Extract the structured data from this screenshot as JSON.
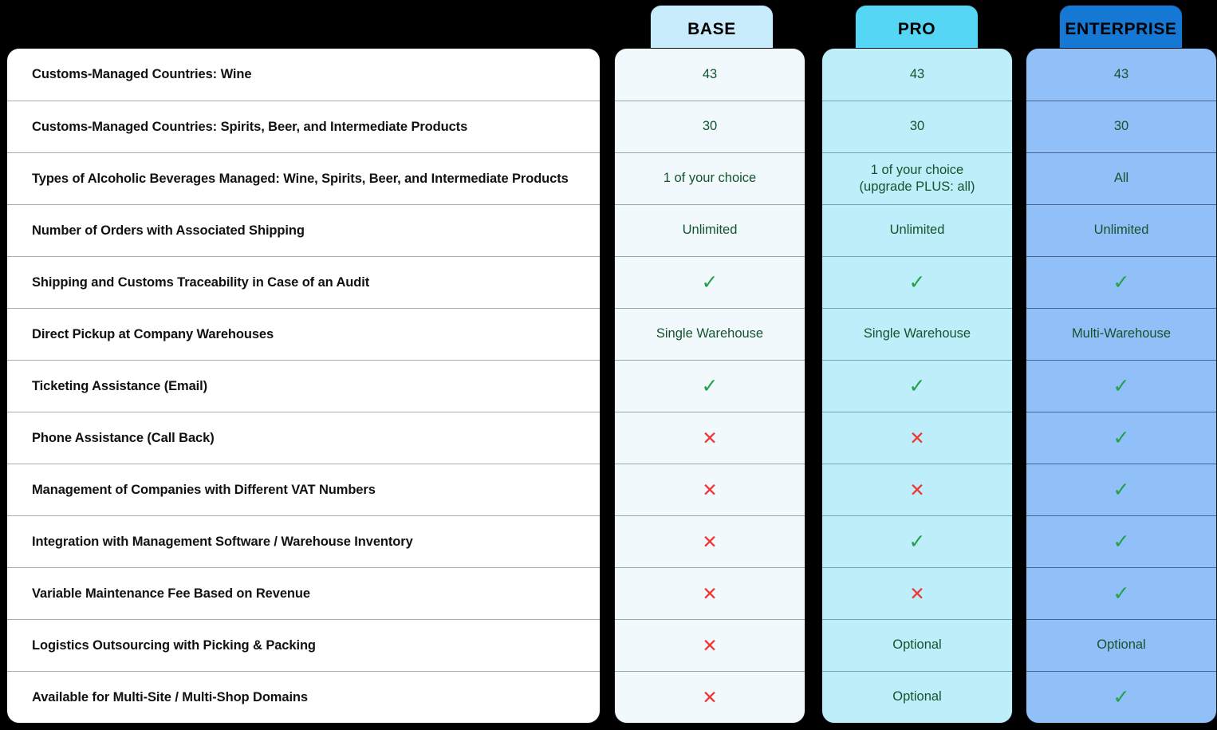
{
  "plans": [
    {
      "id": "base",
      "label": "BASE",
      "header_color": "#c8ecfb",
      "body_color": "#f1f9fd"
    },
    {
      "id": "pro",
      "label": "PRO",
      "header_color": "#55d6f5",
      "body_color": "#bdeefa"
    },
    {
      "id": "enterprise",
      "label": "ENTERPRISE",
      "header_color": "#1578d4",
      "body_color": "#91bff7"
    }
  ],
  "colors": {
    "background": "#000000",
    "value_text": "#14532d",
    "label_text": "#111111",
    "check_green": "#22a045",
    "cross_red": "#f03434"
  },
  "icons": {
    "check": "✓",
    "cross": "✕"
  },
  "rows": [
    {
      "label": "Customs-Managed Countries: Wine",
      "base": "43",
      "pro": "43",
      "enterprise": "43"
    },
    {
      "label": "Customs-Managed Countries: Spirits, Beer, and Intermediate Products",
      "base": "30",
      "pro": "30",
      "enterprise": "30"
    },
    {
      "label": "Types of Alcoholic Beverages Managed: Wine, Spirits, Beer, and Intermediate Products",
      "base": "1 of your choice",
      "pro": "1 of your choice\n(upgrade PLUS: all)",
      "enterprise": "All"
    },
    {
      "label": "Number of Orders with Associated Shipping",
      "base": "Unlimited",
      "pro": "Unlimited",
      "enterprise": "Unlimited"
    },
    {
      "label": "Shipping and Customs Traceability in Case of an Audit",
      "base": "yes",
      "pro": "yes",
      "enterprise": "yes"
    },
    {
      "label": "Direct Pickup at Company Warehouses",
      "base": "Single Warehouse",
      "pro": "Single Warehouse",
      "enterprise": "Multi-Warehouse"
    },
    {
      "label": "Ticketing Assistance (Email)",
      "base": "yes",
      "pro": "yes",
      "enterprise": "yes"
    },
    {
      "label": "Phone Assistance (Call Back)",
      "base": "no",
      "pro": "no",
      "enterprise": "yes"
    },
    {
      "label": "Management of Companies with Different VAT Numbers",
      "base": "no",
      "pro": "no",
      "enterprise": "yes"
    },
    {
      "label": "Integration with Management Software / Warehouse Inventory",
      "base": "no",
      "pro": "yes",
      "enterprise": "yes"
    },
    {
      "label": "Variable Maintenance Fee Based on Revenue",
      "base": "no",
      "pro": "no",
      "enterprise": "yes"
    },
    {
      "label": "Logistics Outsourcing with Picking & Packing",
      "base": "no",
      "pro": "Optional",
      "enterprise": "Optional"
    },
    {
      "label": "Available for Multi-Site / Multi-Shop Domains",
      "base": "no",
      "pro": "Optional",
      "enterprise": "yes"
    }
  ]
}
